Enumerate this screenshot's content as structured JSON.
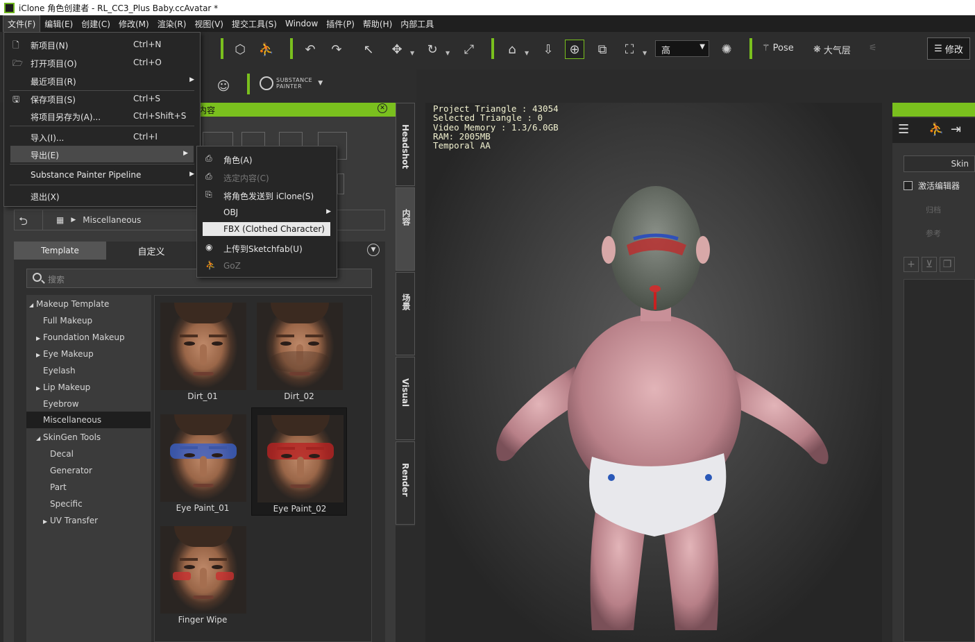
{
  "window": {
    "title": "iClone 角色创建者 - RL_CC3_Plus Baby.ccAvatar *"
  },
  "menubar": [
    "文件(F)",
    "编辑(E)",
    "创建(C)",
    "修改(M)",
    "渲染(R)",
    "视图(V)",
    "提交工具(S)",
    "Window",
    "插件(P)",
    "帮助(H)",
    "内部工具"
  ],
  "toolbar": {
    "quality": "高",
    "pose_label": "Pose",
    "atmosphere_label": "大气层",
    "modify_label": "修改",
    "substance_line1": "SUBSTANCE",
    "substance_line2": "PAINTER"
  },
  "file_menu": {
    "items": [
      {
        "icon": "new-file-icon",
        "glyph": "🗋",
        "label": "新项目(N)",
        "shortcut": "Ctrl+N"
      },
      {
        "icon": "open-folder-icon",
        "glyph": "🗁",
        "label": "打开项目(O)",
        "shortcut": "Ctrl+O"
      },
      {
        "icon": "",
        "glyph": "",
        "label": "最近项目(R)",
        "shortcut": ""
      },
      {
        "icon": "save-icon",
        "glyph": "🖫",
        "label": "保存项目(S)",
        "shortcut": "Ctrl+S"
      },
      {
        "icon": "",
        "glyph": "",
        "label": "将项目另存为(A)...",
        "shortcut": "Ctrl+Shift+S"
      },
      {
        "icon": "",
        "glyph": "",
        "label": "导入(I)...",
        "shortcut": "Ctrl+I"
      },
      {
        "icon": "",
        "glyph": "",
        "label": "导出(E)",
        "shortcut": ""
      },
      {
        "icon": "",
        "glyph": "",
        "label": "Substance Painter Pipeline",
        "shortcut": ""
      },
      {
        "icon": "",
        "glyph": "",
        "label": "退出(X)",
        "shortcut": ""
      }
    ]
  },
  "export_submenu": {
    "items": [
      {
        "label": "角色(A)"
      },
      {
        "label": "选定内容(C)"
      },
      {
        "label": "将角色发送到 iClone(S)"
      },
      {
        "label": "OBJ"
      },
      {
        "label": "FBX (Clothed Character)"
      },
      {
        "label": "上传到Sketchfab(U)"
      },
      {
        "label": "GoZ"
      }
    ]
  },
  "content_panel": {
    "header": "内容",
    "breadcrumb": "Miscellaneous",
    "tabs": [
      "Template",
      "自定义"
    ],
    "search_placeholder": "搜索",
    "tree": [
      "Makeup Template",
      "Full Makeup",
      "Foundation Makeup",
      "Eye Makeup",
      "Eyelash",
      "Lip Makeup",
      "Eyebrow",
      "Miscellaneous",
      "SkinGen Tools",
      "Decal",
      "Generator",
      "Part",
      "Specific",
      "UV Transfer"
    ],
    "thumbnails": [
      "Dirt_01",
      "Dirt_02",
      "Eye Paint_01",
      "Eye Paint_02",
      "Finger Wipe"
    ]
  },
  "side_tabs": [
    "Headshot",
    "内容",
    "场景",
    "Visual",
    "Render"
  ],
  "viewport_stats": [
    "Project Triangle : 43054",
    "Selected Triangle : 0",
    "Video Memory : 1.3/6.0GB",
    "RAM: 2005MB",
    "Temporal AA"
  ],
  "right_panel": {
    "skin_button": "Skin",
    "activate_editor": "激活编辑器",
    "dim1": "归档",
    "dim2": "参考"
  },
  "colors": {
    "accent": "#7ac01e",
    "menu_bg": "#262626",
    "panel_bg": "#3a3a3a"
  }
}
